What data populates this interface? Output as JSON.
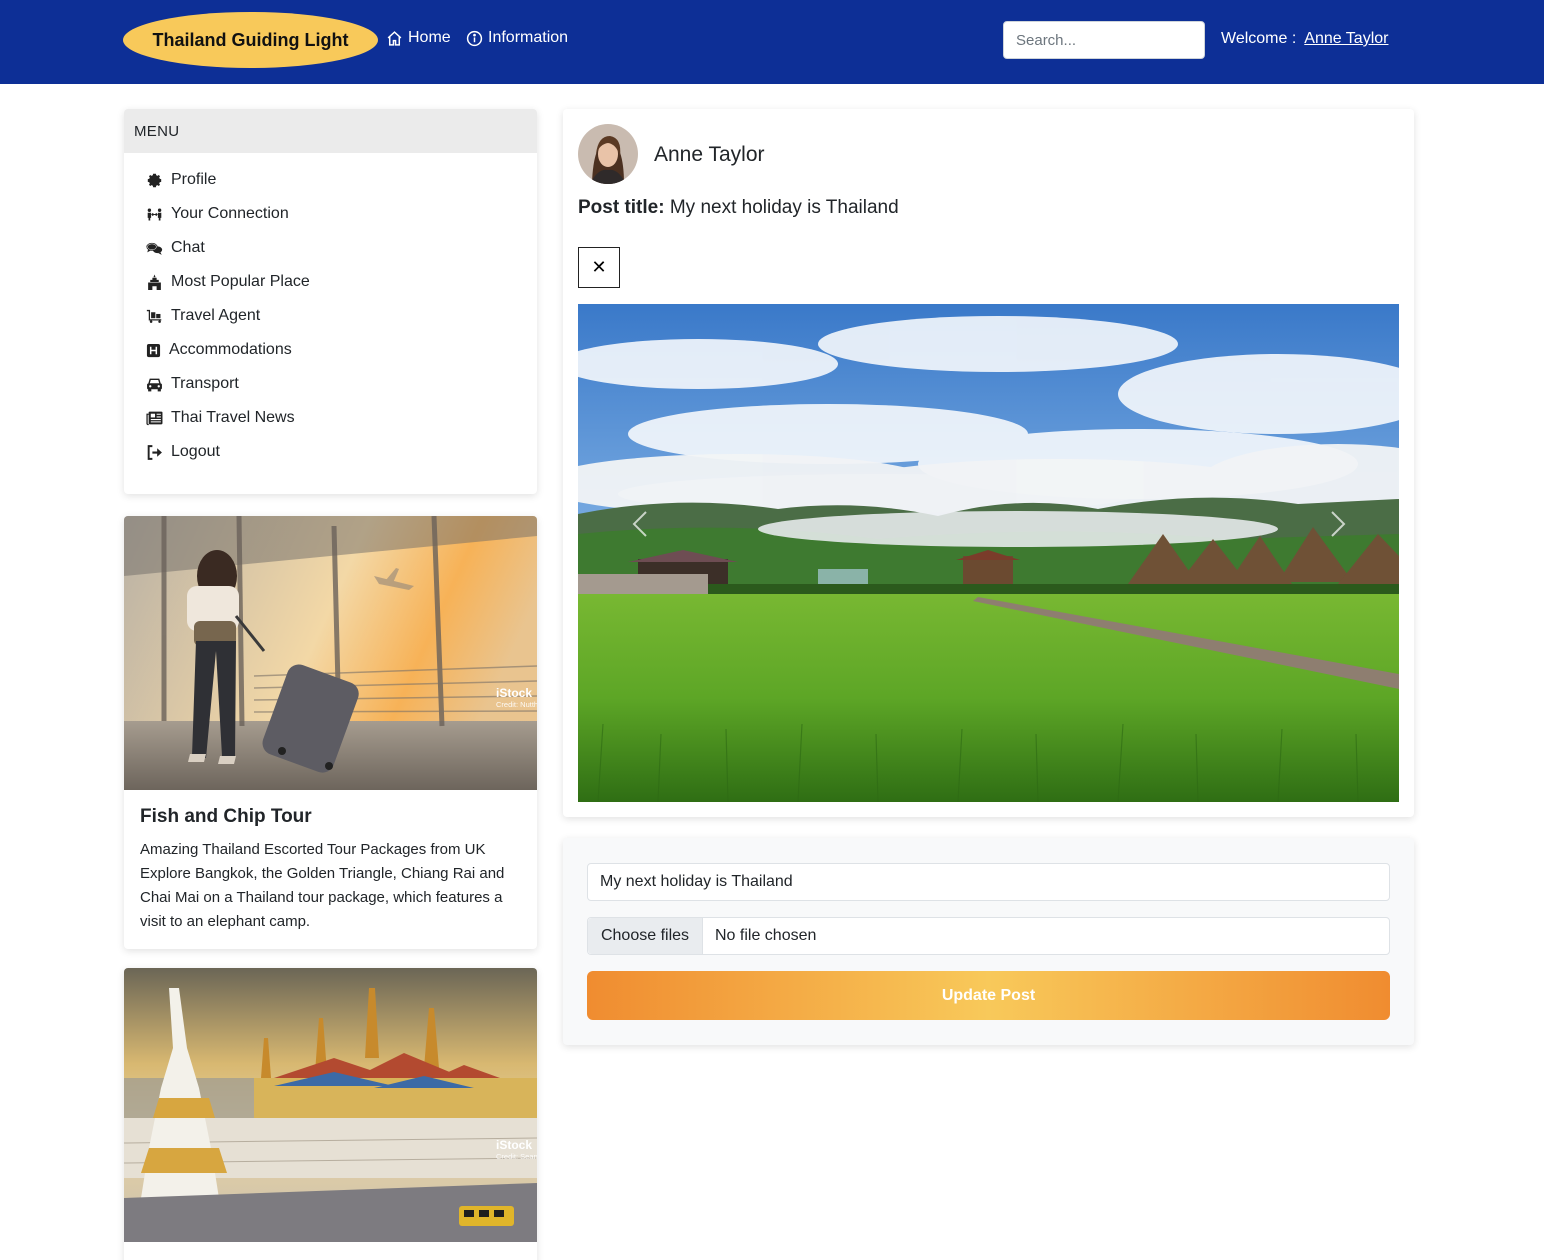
{
  "navbar": {
    "brand": "Thailand Guiding Light",
    "home_label": "Home",
    "info_label": "Information",
    "search_placeholder": "Search...",
    "welcome_label": "Welcome :",
    "user_name": "Anne Taylor",
    "bg_color": "#0d2f96",
    "brand_color": "#f8c95a"
  },
  "menu": {
    "header": "MENU",
    "items": [
      {
        "label": "Profile",
        "icon": "gear-icon"
      },
      {
        "label": "Your Connection",
        "icon": "people-arrows-icon"
      },
      {
        "label": "Chat",
        "icon": "comments-icon"
      },
      {
        "label": "Most Popular Place",
        "icon": "landmark-icon"
      },
      {
        "label": "Travel Agent",
        "icon": "luggage-cart-icon"
      },
      {
        "label": "Accommodations",
        "icon": "hotel-icon"
      },
      {
        "label": "Transport",
        "icon": "car-icon"
      },
      {
        "label": "Thai Travel News",
        "icon": "newspaper-icon"
      },
      {
        "label": "Logout",
        "icon": "logout-icon"
      }
    ]
  },
  "tours": [
    {
      "title": "Fish and Chip Tour",
      "description": "Amazing Thailand Escorted Tour Packages from UK Explore Bangkok, the Golden Triangle, Chiang Rai and Chai Mai on a Thailand tour package, which features a visit to an elephant camp.",
      "watermark": "iStock",
      "credit": "Credit: Nutthaseth Vanchaichana"
    },
    {
      "title": "",
      "description": "",
      "watermark": "iStock",
      "credit": "Credit: Sean Pavone"
    }
  ],
  "post": {
    "author": "Anne Taylor",
    "title_label": "Post title:",
    "title_value": "My next holiday is Thailand",
    "close_symbol": "✕"
  },
  "form": {
    "title_value": "My next holiday is Thailand",
    "choose_files_label": "Choose files",
    "file_status": "No file chosen",
    "submit_label": "Update Post"
  }
}
